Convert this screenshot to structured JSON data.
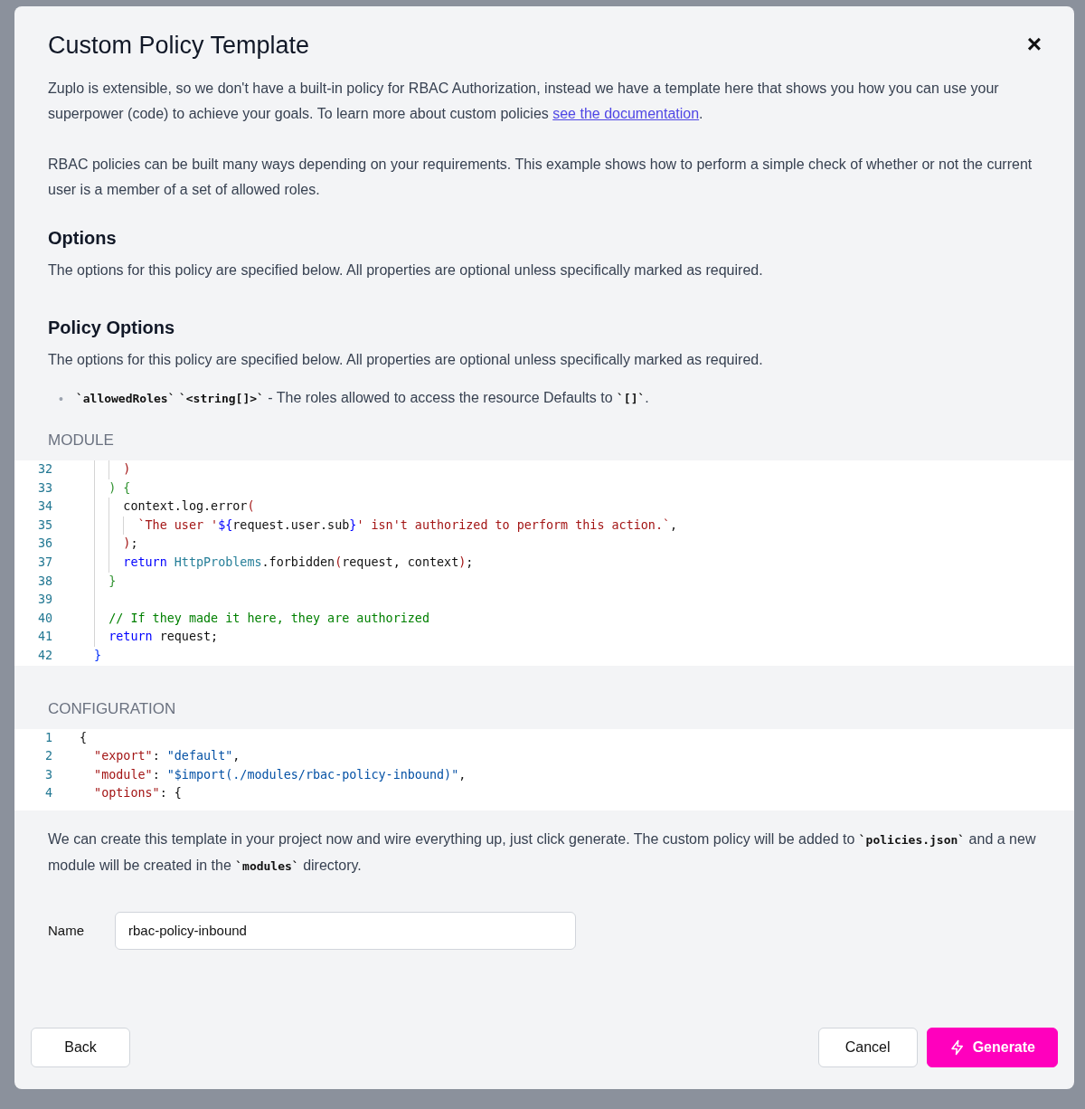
{
  "dialog": {
    "title": "Custom Policy Template",
    "close": "×"
  },
  "intro": [
    {
      "text": "Zuplo is extensible, so we don't have a built-in policy for RBAC Authorization, instead we have a template here that shows you how you can use your superpower (code) to achieve your goals. To learn more about custom policies ",
      "link": "see the documentation",
      "after": "."
    },
    {
      "text": "RBAC policies can be built many ways depending on your requirements. This example shows how to perform a simple check of whether or not the current user is a member of a set of allowed roles."
    }
  ],
  "sections": [
    {
      "heading": "Options",
      "text": "The options for this policy are specified below. All properties are optional unless specifically marked as required."
    },
    {
      "heading": "Policy Options",
      "text": "The options for this policy are specified below. All properties are optional unless specifically marked as required."
    }
  ],
  "option_items": [
    {
      "bullet": "•",
      "text": "**`allowedRoles`** **`<string[]>`** - The roles allowed to access the resource Defaults to **`[]`**."
    }
  ],
  "module": {
    "label": "MODULE",
    "lines": [
      {
        "number": "32",
        "tokens": [
          {
            "kind": "b-red",
            "text": "      )"
          }
        ]
      },
      {
        "number": "33",
        "tokens": [
          {
            "kind": "b-green",
            "text": "    ) {"
          }
        ]
      },
      {
        "number": "34",
        "tokens": [
          {
            "kind": "plain",
            "text": "      context.log.error"
          },
          {
            "kind": "b-red",
            "text": "("
          }
        ]
      },
      {
        "number": "35",
        "tokens": [
          {
            "kind": "str",
            "text": "        `The user '"
          },
          {
            "kind": "kw",
            "text": "${"
          },
          {
            "kind": "plain",
            "text": "request.user.sub"
          },
          {
            "kind": "kw",
            "text": "}"
          },
          {
            "kind": "str",
            "text": "' isn't authorized to perform this action.`"
          },
          {
            "kind": "plain",
            "text": ","
          }
        ]
      },
      {
        "number": "36",
        "tokens": [
          {
            "kind": "b-red",
            "text": "      )"
          },
          {
            "kind": "plain",
            "text": ";"
          }
        ]
      },
      {
        "number": "37",
        "tokens": [
          {
            "kind": "kw",
            "text": "      return "
          },
          {
            "kind": "type",
            "text": "HttpProblems"
          },
          {
            "kind": "plain",
            "text": ".forbidden"
          },
          {
            "kind": "b-red",
            "text": "("
          },
          {
            "kind": "plain",
            "text": "request, context"
          },
          {
            "kind": "b-red",
            "text": ")"
          },
          {
            "kind": "plain",
            "text": ";"
          }
        ]
      },
      {
        "number": "38",
        "tokens": [
          {
            "kind": "b-green",
            "text": "    }"
          }
        ]
      },
      {
        "number": "39"
      },
      {
        "number": "40",
        "tokens": [
          {
            "kind": "cmt",
            "text": "    // If they made it here, they are authorized"
          }
        ]
      },
      {
        "number": "41",
        "tokens": [
          {
            "kind": "kw",
            "text": "    return"
          },
          {
            "kind": "plain",
            "text": " request;"
          }
        ]
      },
      {
        "number": "42",
        "tokens": [
          {
            "kind": "b-blue",
            "text": "  }"
          }
        ]
      }
    ]
  },
  "configuration": {
    "label": "CONFIGURATION",
    "lines": [
      {
        "number": "1",
        "tokens": [
          {
            "kind": "plain",
            "text": "{"
          }
        ]
      },
      {
        "number": "2",
        "tokens": [
          {
            "kind": "key",
            "text": "  \"export\""
          },
          {
            "kind": "plain",
            "text": ": "
          },
          {
            "kind": "val",
            "text": "\"default\""
          },
          {
            "kind": "plain",
            "text": ","
          }
        ]
      },
      {
        "number": "3",
        "tokens": [
          {
            "kind": "key",
            "text": "  \"module\""
          },
          {
            "kind": "plain",
            "text": ": "
          },
          {
            "kind": "val",
            "text": "\"$import(./modules/rbac-policy-inbound)\""
          },
          {
            "kind": "plain",
            "text": ","
          }
        ]
      },
      {
        "number": "4",
        "tokens": [
          {
            "kind": "key",
            "text": "  \"options\""
          },
          {
            "kind": "plain",
            "text": ": {"
          }
        ]
      }
    ]
  },
  "generate_note": "We can create this template in your project now and wire everything up, just click generate. The custom policy will be added to **`policies.json`** and a new module will be created in the **`modules`** directory.",
  "name_field": {
    "label": "Name",
    "value": "rbac-policy-inbound"
  },
  "buttons": {
    "back": "Back",
    "cancel": "Cancel",
    "generate": "Generate"
  }
}
